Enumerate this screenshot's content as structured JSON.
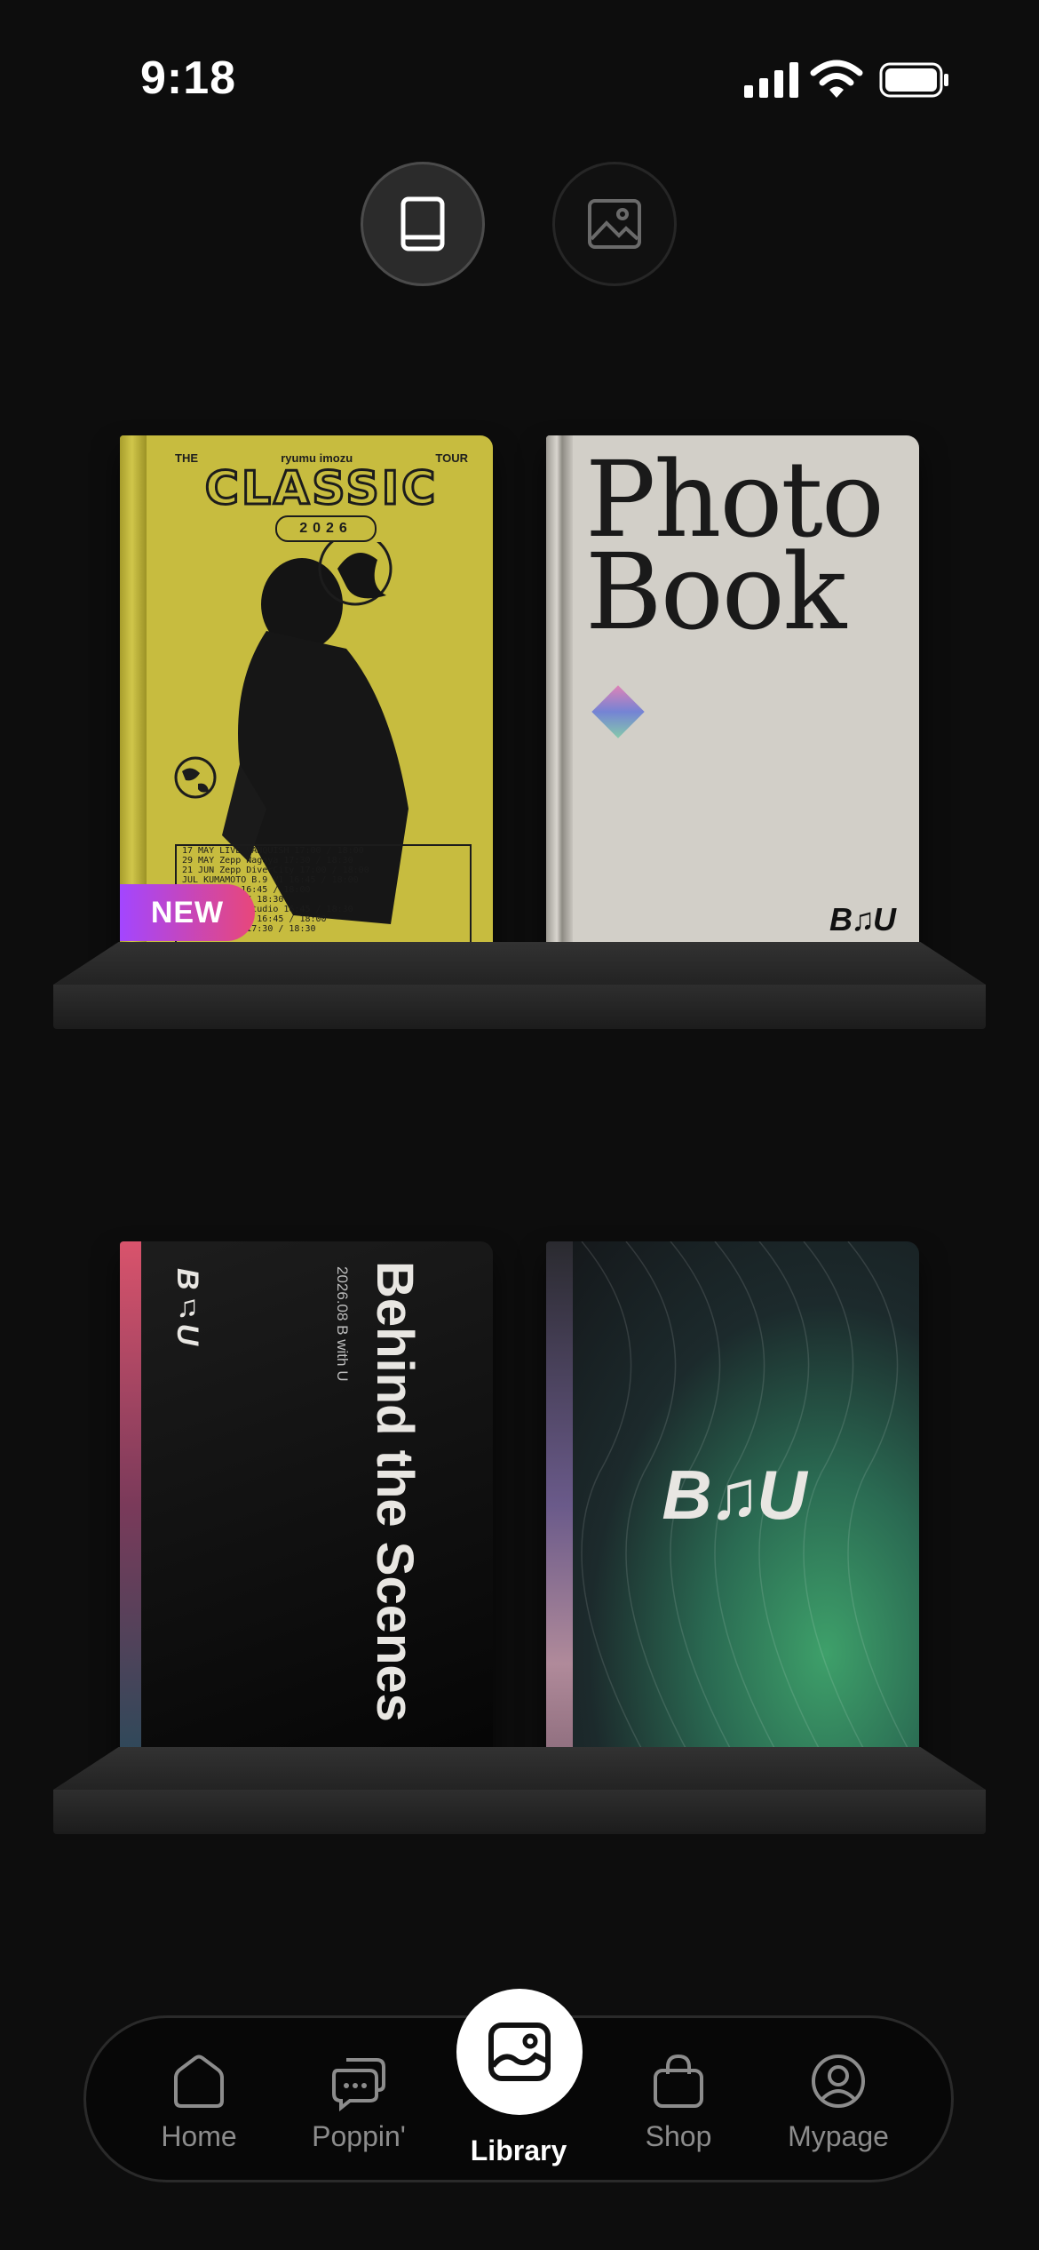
{
  "status_bar": {
    "time": "9:18"
  },
  "view_toggle": {
    "options": [
      {
        "name": "book-view",
        "icon": "book-icon",
        "selected": true
      },
      {
        "name": "photo-view",
        "icon": "image-icon",
        "selected": false
      }
    ]
  },
  "shelves": [
    {
      "books": [
        {
          "cover_title": "CLASSIC",
          "cover_top_left": "THE",
          "cover_top_center": "ryumu imozu",
          "cover_top_right": "TOUR",
          "cover_year": "2026",
          "schedule": [
            "17  MAY  LIVE VANQUISH   17:00 / 18:00",
            "29  MAY  Zepp Nagoya     17:30 / 18:30",
            "21  JUN  Zepp DiverCity  17:00 / 18:00",
            "    JUL  KUMAMOTO B.9 V1 16:45 / 18:00",
            "         DRUM LOGOS      16:45 / 18:00",
            "         Rensa           17:30 / 18:30",
            "         Lake Harbor Studio 16:45 / 18:30",
            "         PENNY LANE 24   16:45 / 18:00",
            "         Namba Hatch     17:30 / 18:30"
          ],
          "badge": "NEW"
        },
        {
          "cover_title_line1": "Photo",
          "cover_title_line2": "Book",
          "logo": "B♫U"
        }
      ]
    },
    {
      "books": [
        {
          "cover_title_line1": "Behind",
          "cover_title_line2": "the Scenes",
          "cover_subtitle": "2026.08 B with U",
          "logo": "B♫U"
        },
        {
          "logo": "B♫U"
        }
      ]
    }
  ],
  "tab_bar": {
    "items": [
      {
        "label": "Home",
        "icon": "home-icon"
      },
      {
        "label": "Poppin'",
        "icon": "chat-bubbles-icon"
      },
      {
        "label": "Library",
        "icon": "image-icon",
        "active": true
      },
      {
        "label": "Shop",
        "icon": "shopping-bag-icon"
      },
      {
        "label": "Mypage",
        "icon": "profile-icon"
      }
    ]
  },
  "colors": {
    "background": "#0d0d0d",
    "badge_gradient_start": "#a346ff",
    "badge_gradient_end": "#e8477a",
    "classic_cover": "#c7bc3f"
  }
}
